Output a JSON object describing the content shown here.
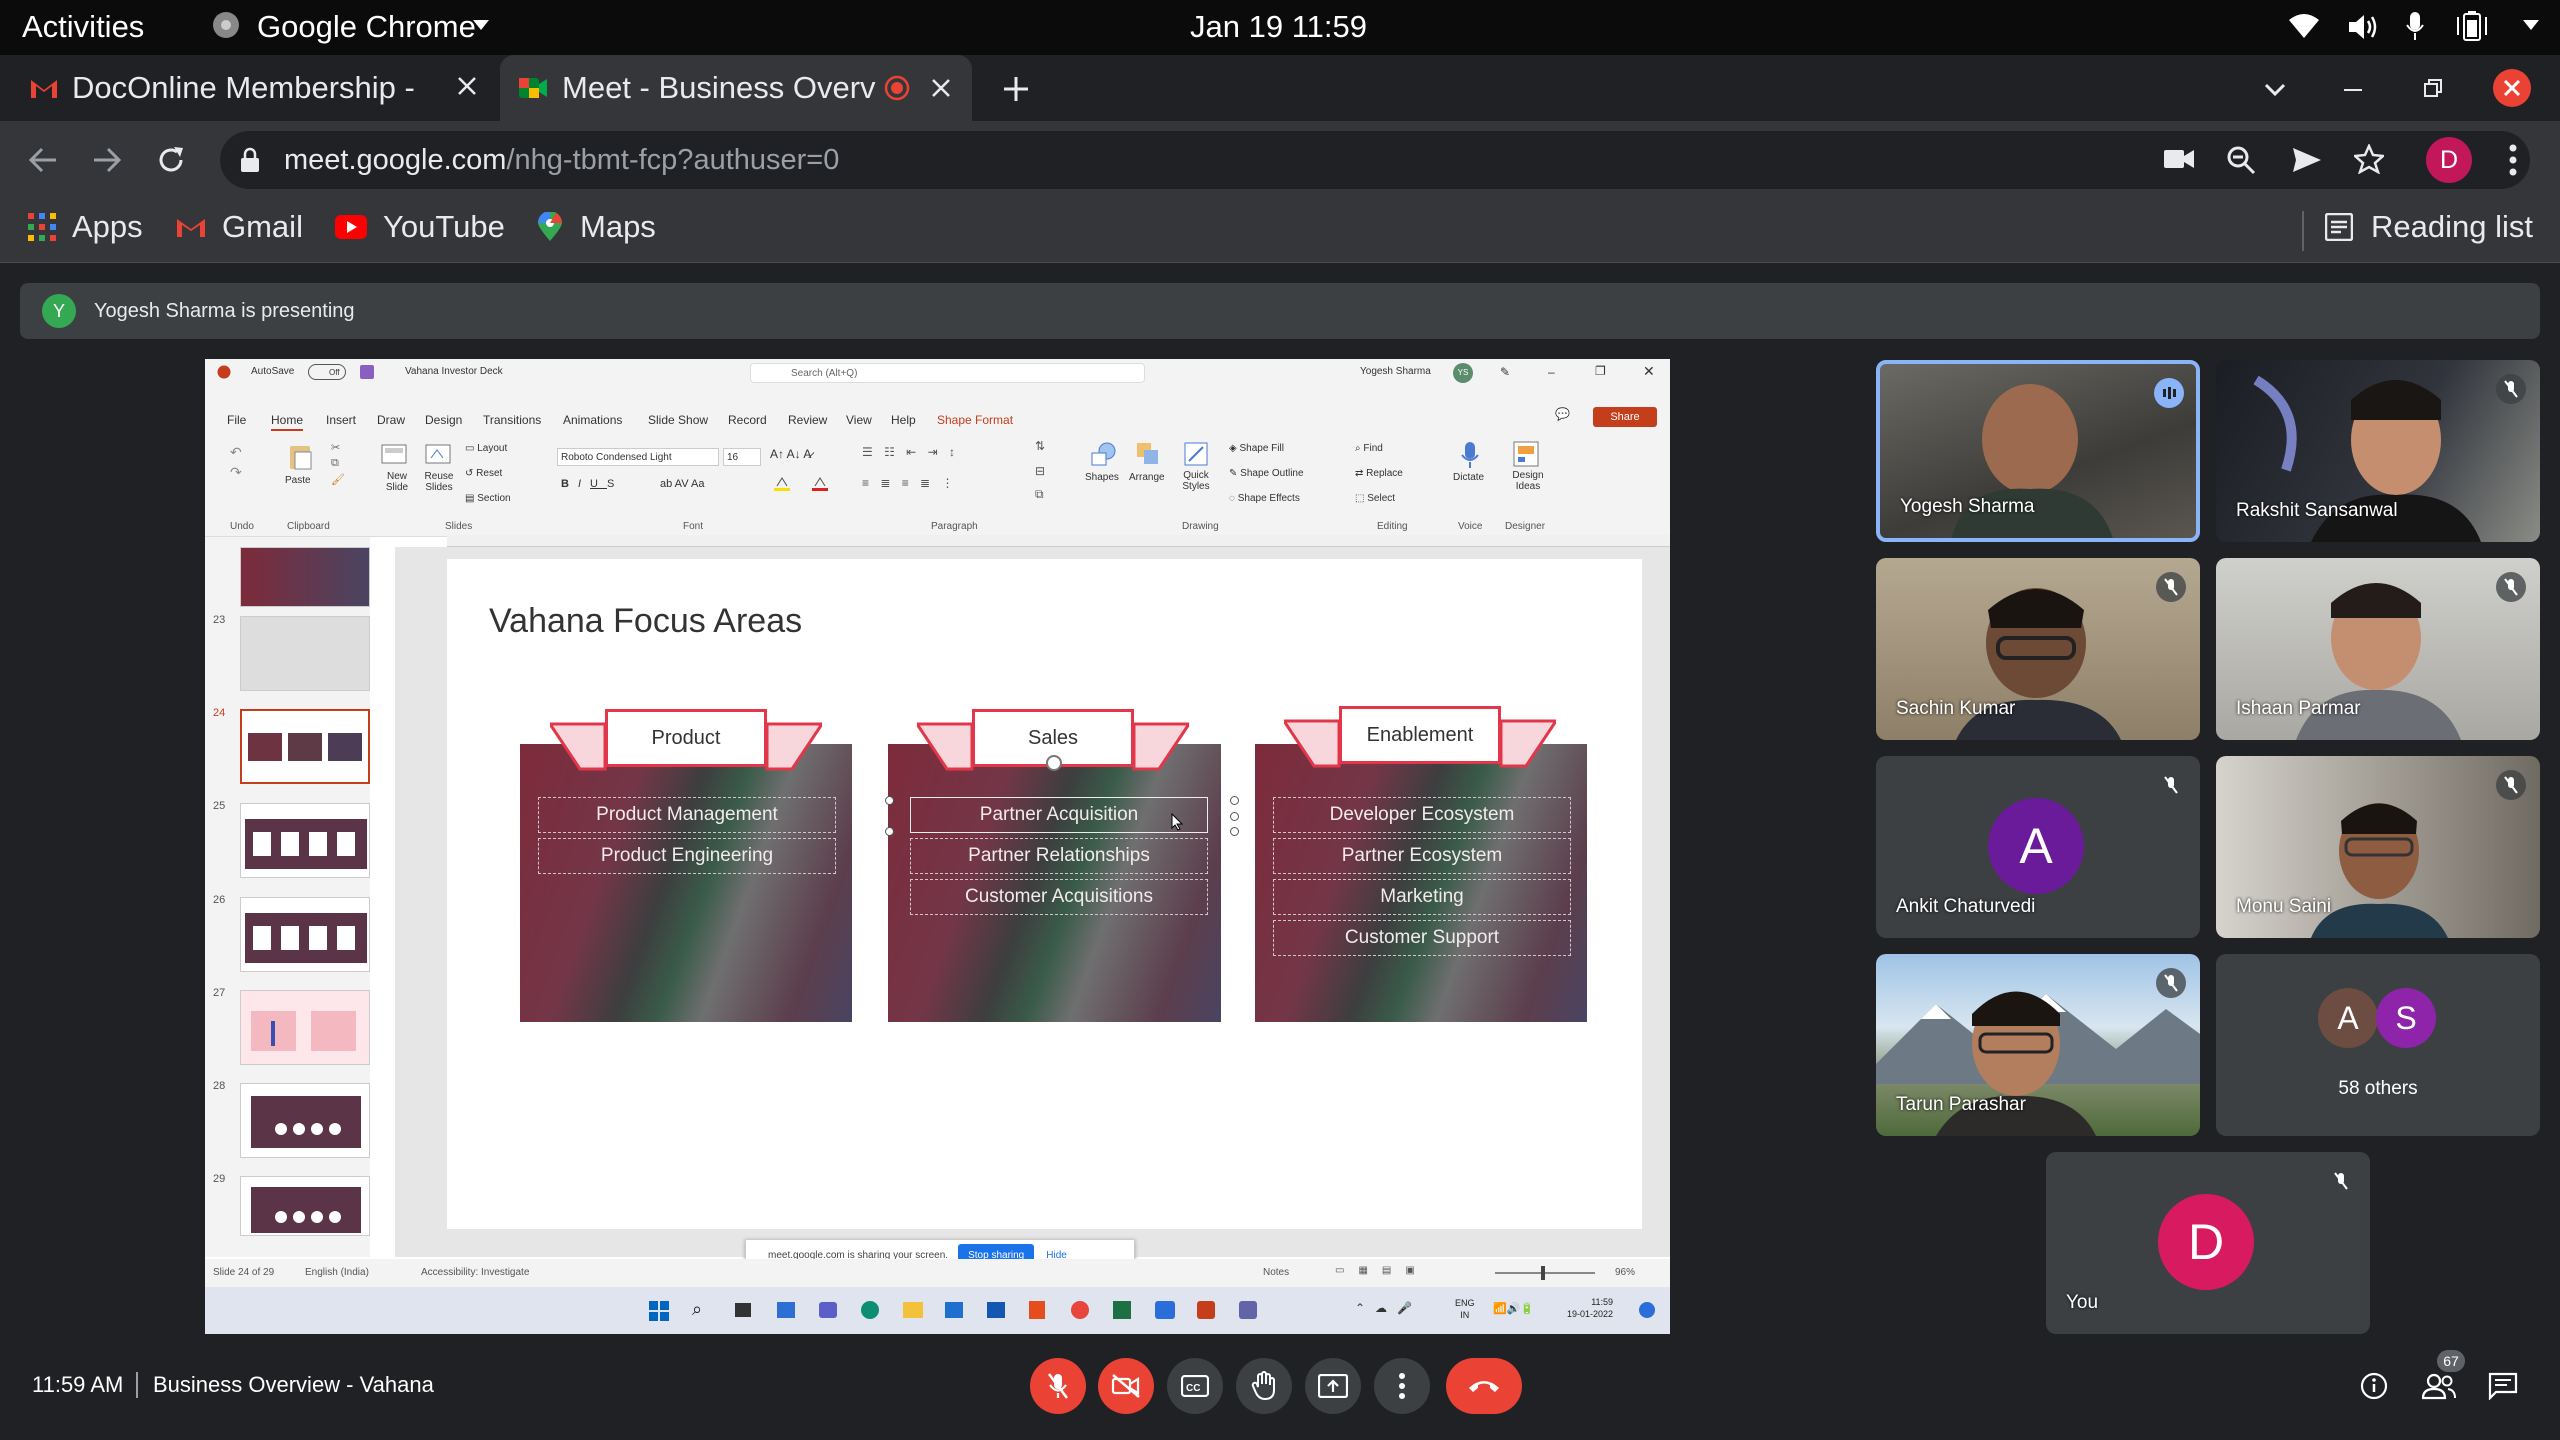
{
  "os": {
    "activities": "Activities",
    "app_name": "Google Chrome",
    "datetime": "Jan 19  11:59"
  },
  "tabs": [
    {
      "title": "DocOnline Membership - ",
      "favicon": "gmail-icon"
    },
    {
      "title": "Meet - Business Overv",
      "favicon": "meet-icon",
      "recording": true
    }
  ],
  "address": {
    "domain": "meet.google.com",
    "path": "/nhg-tbmt-fcp?authuser=0"
  },
  "profile_initial": "D",
  "bookmarks": [
    {
      "label": "Apps",
      "icon": "apps-grid-icon"
    },
    {
      "label": "Gmail",
      "icon": "gmail-icon"
    },
    {
      "label": "YouTube",
      "icon": "youtube-icon"
    },
    {
      "label": "Maps",
      "icon": "maps-icon"
    }
  ],
  "reading_list": "Reading list",
  "meet": {
    "presenter_initial": "Y",
    "presenting_text": "Yogesh Sharma is presenting",
    "time": "11:59 AM",
    "meeting_title": "Business Overview - Vahana",
    "participants_count": "67",
    "tiles": [
      {
        "name": "Yogesh Sharma",
        "speaking": true
      },
      {
        "name": "Rakshit Sansanwal"
      },
      {
        "name": "Sachin Kumar"
      },
      {
        "name": "Ishaan Parmar"
      },
      {
        "name": "Ankit Chaturvedi",
        "initial": "A",
        "color": "#6a1b9a"
      },
      {
        "name": "Monu Saini"
      },
      {
        "name": "Tarun Parashar"
      },
      {
        "name": "58 others",
        "initials": [
          "A",
          "S"
        ]
      },
      {
        "name": "You",
        "initial": "D",
        "color": "#d81b60"
      }
    ]
  },
  "ppt": {
    "autosave": "AutoSave",
    "autosave_state": "Off",
    "file": "Vahana Investor Deck",
    "search": "Search (Alt+Q)",
    "user": "Yogesh Sharma",
    "user_initials": "YS",
    "share": "Share",
    "tabs": [
      "File",
      "Home",
      "Insert",
      "Draw",
      "Design",
      "Transitions",
      "Animations",
      "Slide Show",
      "Record",
      "Review",
      "View",
      "Help",
      "Shape Format"
    ],
    "groups": [
      "Undo",
      "Clipboard",
      "Slides",
      "Font",
      "Paragraph",
      "Drawing",
      "Editing",
      "Voice",
      "Designer"
    ],
    "font_name": "Roboto Condensed Light",
    "font_size": "16",
    "ribbon": {
      "paste": "Paste",
      "new_slide": "New Slide",
      "reuse_slides": "Reuse Slides",
      "layout": "Layout",
      "reset": "Reset",
      "section": "Section",
      "shapes": "Shapes",
      "arrange": "Arrange",
      "quick_styles": "Quick Styles",
      "shape_fill": "Shape Fill",
      "shape_outline": "Shape Outline",
      "shape_effects": "Shape Effects",
      "find": "Find",
      "replace": "Replace",
      "select": "Select",
      "dictate": "Dictate",
      "design_ideas": "Design Ideas"
    },
    "slide_numbers": [
      "23",
      "24",
      "25",
      "26",
      "27",
      "28",
      "29"
    ],
    "slide_title": "Vahana Focus Areas",
    "columns": [
      {
        "header": "Product",
        "items": [
          "Product Management",
          "Product Engineering"
        ]
      },
      {
        "header": "Sales",
        "items": [
          "Partner Acquisition",
          "Partner Relationships",
          "Customer Acquisitions"
        ]
      },
      {
        "header": "Enablement",
        "items": [
          "Developer Ecosystem",
          "Partner Ecosystem",
          "Marketing",
          "Customer Support"
        ]
      }
    ],
    "status_slide": "Slide 24 of 29",
    "status_lang": "English (India)",
    "status_access": "Accessibility: Investigate",
    "notes": "Notes",
    "zoom": "96%",
    "sharing_text": "meet.google.com is sharing your screen.",
    "stop_sharing": "Stop sharing",
    "hide": "Hide",
    "taskbar_lang": "ENG",
    "taskbar_region": "IN",
    "taskbar_time": "11:59",
    "taskbar_date": "19-01-2022"
  },
  "colors": {
    "accent_red": "#ea4335",
    "speaking_blue": "#8ab4f8",
    "ppt_red": "#c43e1c"
  }
}
